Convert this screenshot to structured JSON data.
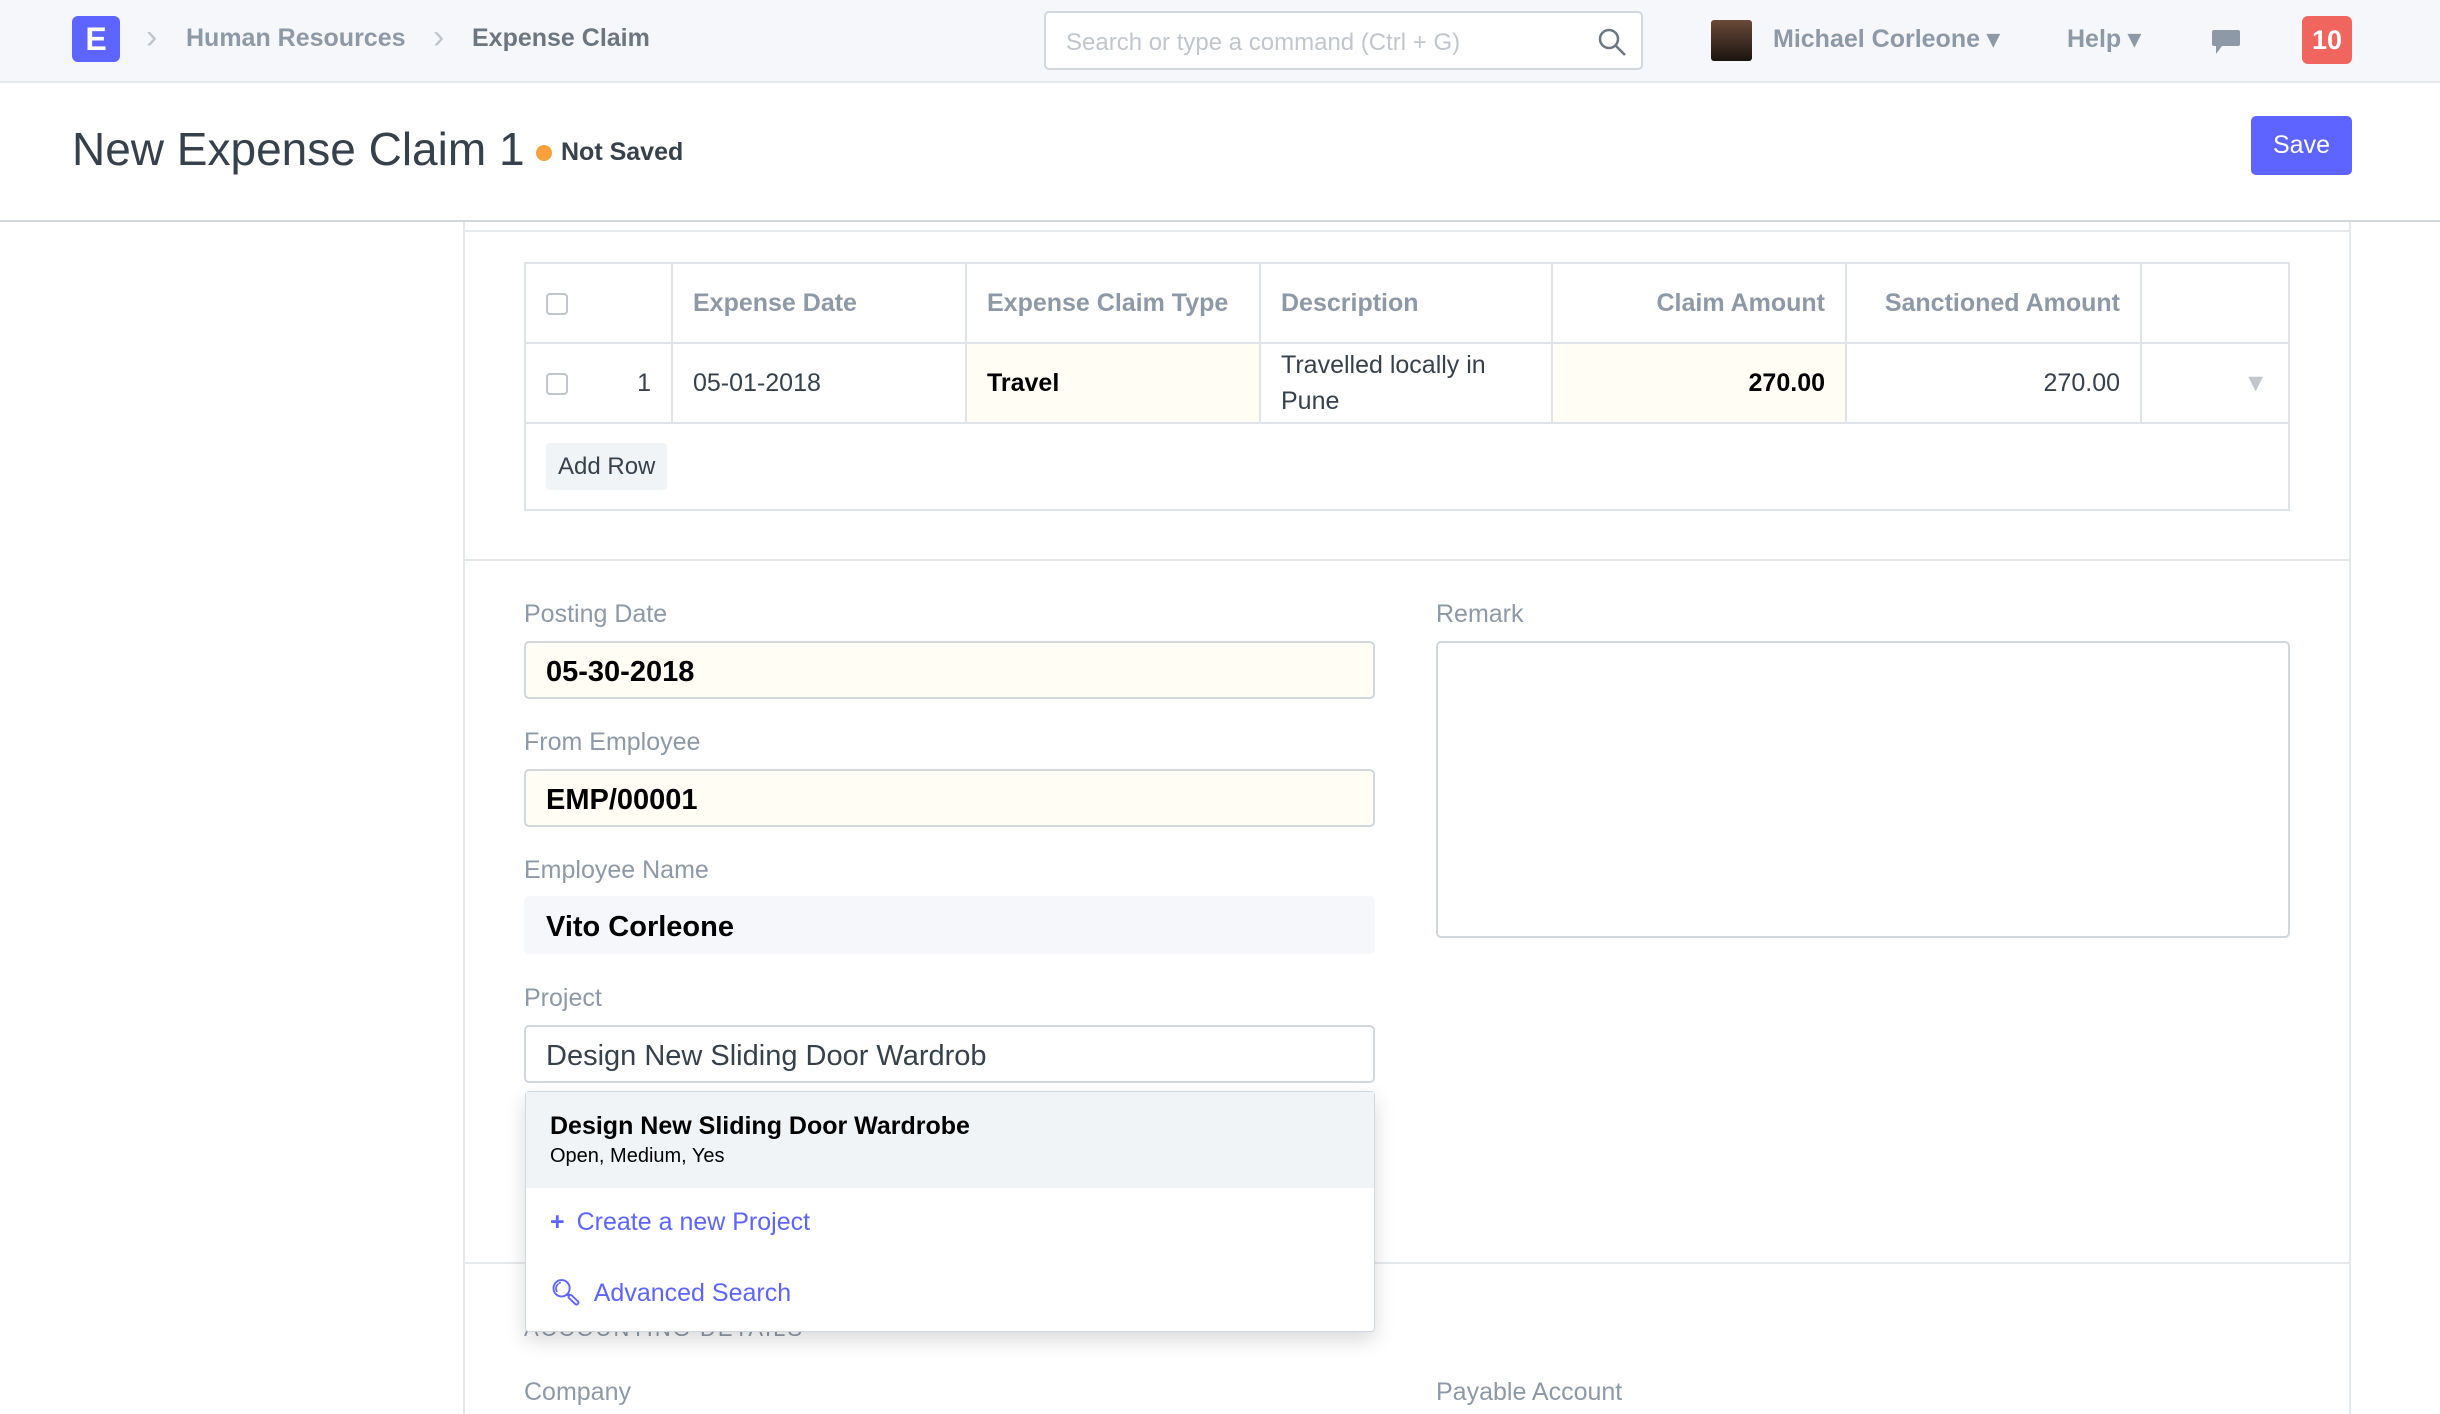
{
  "nav": {
    "logo": "E",
    "breadcrumbs": [
      "Human Resources",
      "Expense Claim"
    ],
    "search_placeholder": "Search or type a command (Ctrl + G)",
    "user": "Michael Corleone",
    "help": "Help",
    "notifications": "10"
  },
  "header": {
    "title": "New Expense Claim 1",
    "status": "Not Saved",
    "save": "Save"
  },
  "table": {
    "columns": [
      "Expense Date",
      "Expense Claim Type",
      "Description",
      "Claim Amount",
      "Sanctioned Amount"
    ],
    "rows": [
      {
        "idx": "1",
        "date": "05-01-2018",
        "type": "Travel",
        "description": "Travelled locally in Pune",
        "claim": "270.00",
        "sanctioned": "270.00"
      }
    ],
    "add_row": "Add Row"
  },
  "fields": {
    "posting_date_label": "Posting Date",
    "posting_date": "05-30-2018",
    "from_employee_label": "From Employee",
    "from_employee": "EMP/00001",
    "employee_name_label": "Employee Name",
    "employee_name": "Vito Corleone",
    "project_label": "Project",
    "project": "Design New Sliding Door Wardrob",
    "remark_label": "Remark",
    "remark": "",
    "company_label": "Company",
    "payable_label": "Payable Account",
    "section": "ACCOUNTING DETAILS"
  },
  "dropdown": {
    "title": "Design New Sliding Door Wardrobe",
    "sub": "Open, Medium, Yes",
    "create": "Create a new Project",
    "advanced": "Advanced Search"
  },
  "colors": {
    "primary": "#5e64ff",
    "badge": "#f0655e",
    "status_dot": "#f8a13a"
  }
}
